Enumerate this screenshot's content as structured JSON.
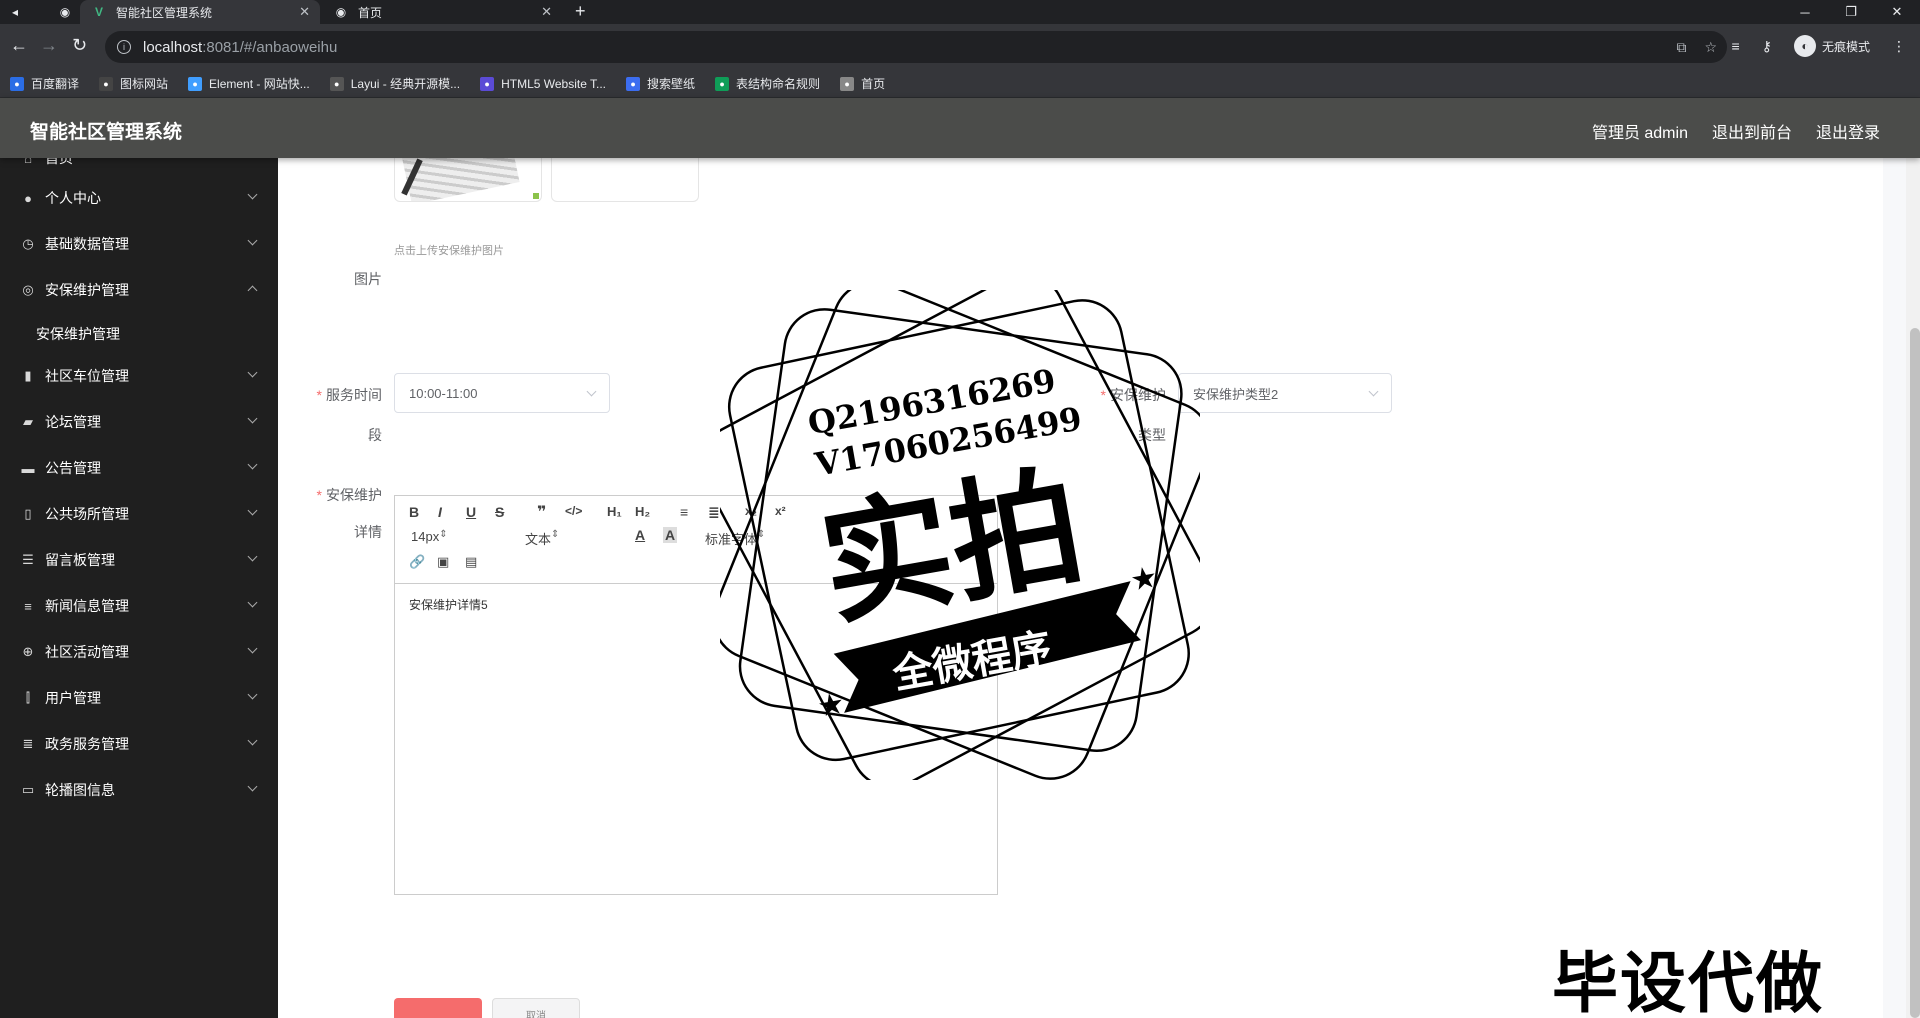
{
  "browser": {
    "tabs": [
      {
        "title": "智能社区管理系统",
        "active": true
      },
      {
        "title": "首页",
        "active": false
      }
    ],
    "url_host": "localhost",
    "url_rest": ":8081/#/anbaoweihu",
    "incognito_label": "无痕模式",
    "bookmarks": [
      {
        "label": "百度翻译",
        "color": "#2b6de5"
      },
      {
        "label": "图标网站",
        "color": "#444"
      },
      {
        "label": "Element - 网站快...",
        "color": "#409eff"
      },
      {
        "label": "Layui - 经典开源模...",
        "color": "#555"
      },
      {
        "label": "HTML5 Website T...",
        "color": "#5b4bd6"
      },
      {
        "label": "搜索壁纸",
        "color": "#3c6df0"
      },
      {
        "label": "表结构命名规则",
        "color": "#0f9d58"
      },
      {
        "label": "首页",
        "color": "#888"
      }
    ]
  },
  "header": {
    "title": "智能社区管理系统",
    "admin": "管理员 admin",
    "exit_front": "退出到前台",
    "logout": "退出登录"
  },
  "sidebar": {
    "items": [
      {
        "label": "首页",
        "icon": "home-icon"
      },
      {
        "label": "个人中心",
        "icon": "user-icon"
      },
      {
        "label": "基础数据管理",
        "icon": "clock-icon"
      },
      {
        "label": "安保维护管理",
        "icon": "shield-icon"
      },
      {
        "label": "安保维护管理",
        "icon": "",
        "sub": true
      },
      {
        "label": "社区车位管理",
        "icon": "parking-icon"
      },
      {
        "label": "论坛管理",
        "icon": "forum-icon"
      },
      {
        "label": "公告管理",
        "icon": "notice-icon"
      },
      {
        "label": "公共场所管理",
        "icon": "place-icon"
      },
      {
        "label": "留言板管理",
        "icon": "message-icon"
      },
      {
        "label": "新闻信息管理",
        "icon": "news-icon"
      },
      {
        "label": "社区活动管理",
        "icon": "activity-icon"
      },
      {
        "label": "用户管理",
        "icon": "users-icon"
      },
      {
        "label": "政务服务管理",
        "icon": "service-icon"
      },
      {
        "label": "轮播图信息",
        "icon": "carousel-icon"
      }
    ]
  },
  "form": {
    "upload_hint": "点击上传安保维护图片",
    "image_label": "图片",
    "time_label_1": "服务时间",
    "time_label_2": "段",
    "time_value": "10:00-11:00",
    "type_label_1": "安保维护",
    "type_label_2": "类型",
    "type_value": "安保维护类型2",
    "detail_label_1": "安保维护",
    "detail_label_2": "详情",
    "editor": {
      "font_size": "14px",
      "format": "文本",
      "font": "标准字体",
      "content": "安保维护详情5"
    },
    "cancel_partial": "取消"
  },
  "watermark": {
    "qq": "Q2196316269",
    "wechat": "V1706025649​9",
    "big": "实拍",
    "ribbon": "全微程序",
    "corner": "毕设代做"
  }
}
